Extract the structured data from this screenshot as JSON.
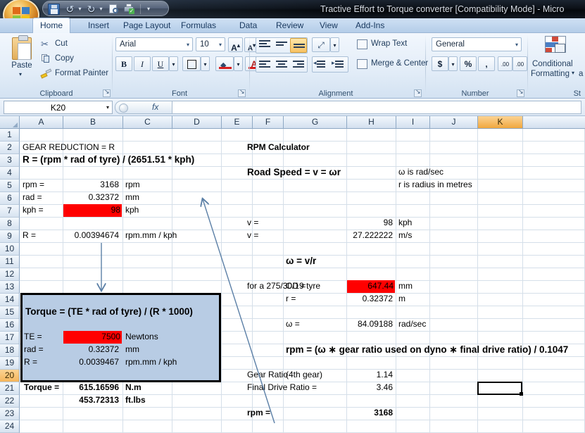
{
  "window": {
    "title": "Tractive Effort to Torque converter  [Compatibility Mode]  -  Micro",
    "orb_name": "office-button"
  },
  "quick_access": {
    "items": [
      "save-icon",
      "undo-icon",
      "undo-dropdown",
      "redo-icon",
      "redo-dropdown",
      "print-preview-icon",
      "quick-print-icon",
      "customize-icon"
    ]
  },
  "ribbon": {
    "tabs": [
      "Home",
      "Insert",
      "Page Layout",
      "Formulas",
      "Data",
      "Review",
      "View",
      "Add-Ins"
    ],
    "active_tab": "Home",
    "groups": {
      "clipboard": {
        "label": "Clipboard",
        "paste": "Paste",
        "cut": "Cut",
        "copy": "Copy",
        "format_painter": "Format Painter"
      },
      "font": {
        "label": "Font",
        "font_name": "Arial",
        "font_size": "10",
        "grow_font": "A",
        "shrink_font": "A",
        "bold": "B",
        "italic": "I",
        "underline": "U"
      },
      "alignment": {
        "label": "Alignment",
        "wrap_text": "Wrap Text",
        "merge_center": "Merge & Center"
      },
      "number": {
        "label": "Number",
        "format": "General",
        "currency": "$",
        "percent": "%",
        "comma": ",",
        "increase_decimal": ".00",
        "decrease_decimal": ".00"
      },
      "styles": {
        "label": "St",
        "conditional_formatting": "Conditional",
        "conditional_formatting2": "Formatting",
        "trailing": "a"
      }
    }
  },
  "formula_bar": {
    "name_box": "K20",
    "formula": "",
    "fx_label": "fx"
  },
  "sheet": {
    "columns": [
      "A",
      "B",
      "C",
      "D",
      "E",
      "F",
      "G",
      "H",
      "I",
      "J",
      "K"
    ],
    "selected_column": "K",
    "selected_row": "20",
    "selected_cell": "K20",
    "rows": [
      "1",
      "2",
      "3",
      "4",
      "5",
      "6",
      "7",
      "8",
      "9",
      "10",
      "11",
      "12",
      "13",
      "14",
      "15",
      "16",
      "17",
      "18",
      "19",
      "20",
      "21",
      "22",
      "23",
      "24"
    ],
    "cells": {
      "A2": "GEAR REDUCTION = R",
      "A3": "R = (rpm * rad of tyre) / (2651.51 * kph)",
      "A5": "rpm =",
      "B5": "3168",
      "C5": "rpm",
      "A6": "rad =",
      "B6": "0.32372",
      "C6": "mm",
      "A7": "kph =",
      "B7": "98",
      "C7": "kph",
      "A9": "R =",
      "B9": "0.00394674",
      "C9": "rpm.mm /  kph",
      "A14": "Torque = (TE * rad of tyre) / (R * 1000)",
      "A16": "TE =",
      "B16": "7500",
      "C16": "Newtons",
      "A17": "rad =",
      "B17": "0.32372",
      "C17": "mm",
      "A18": "R =",
      "B18": "0.0039467",
      "C18": "rpm.mm /  kph",
      "A20": "Torque =",
      "B20": "615.16596",
      "C20": "N.m",
      "B21": "453.72313",
      "C21": "ft.lbs",
      "F2": "RPM Calculator",
      "F4": "Road Speed = v = ωr",
      "I4": "ω is rad/sec",
      "I5": "r is radius in metres",
      "F8": "v =",
      "H8": "98",
      "I8": "kph",
      "F9": "v =",
      "H9": "27.222222",
      "I9": "m/s",
      "G11": "ω = v/r",
      "F13": "for a 275/30/19 tyre",
      "G13": "OD =",
      "H13": "647.44",
      "I13": "mm",
      "G14": "r =",
      "H14": "0.32372",
      "I14": "m",
      "G16": "ω =",
      "H16": "84.09188",
      "I16": "rad/sec",
      "F18": "rpm = (ω ∗ gear ratio used on dyno ∗ final drive ratio) / 0.1047",
      "F20": "Gear Ratio",
      "G20": "(4th gear)",
      "H20": "1.14",
      "F21": "Final Drive Ratio =",
      "H21": "3.46",
      "F23": "rpm =",
      "H23": "3168"
    },
    "highlight_color": "#ff0000",
    "box_fill_color": "#b8cce4"
  }
}
